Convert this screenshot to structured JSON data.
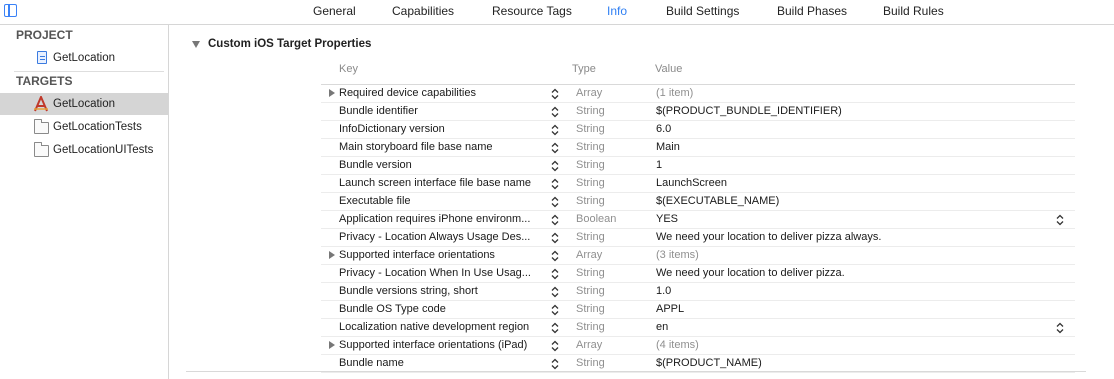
{
  "tabs": [
    {
      "label": "General",
      "active": false
    },
    {
      "label": "Capabilities",
      "active": false
    },
    {
      "label": "Resource Tags",
      "active": false
    },
    {
      "label": "Info",
      "active": true
    },
    {
      "label": "Build Settings",
      "active": false
    },
    {
      "label": "Build Phases",
      "active": false
    },
    {
      "label": "Build Rules",
      "active": false
    }
  ],
  "sidebar": {
    "project_title": "PROJECT",
    "project_items": [
      {
        "label": "GetLocation",
        "icon": "project-document-icon"
      }
    ],
    "targets_title": "TARGETS",
    "target_items": [
      {
        "label": "GetLocation",
        "icon": "app-target-icon",
        "selected": true
      },
      {
        "label": "GetLocationTests",
        "icon": "folder-icon",
        "selected": false
      },
      {
        "label": "GetLocationUITests",
        "icon": "folder-icon",
        "selected": false
      }
    ]
  },
  "main": {
    "section_title": "Custom iOS Target Properties",
    "columns": {
      "key": "Key",
      "type": "Type",
      "value": "Value"
    },
    "rows": [
      {
        "key": "Required device capabilities",
        "type": "Array",
        "value": "(1 item)",
        "expandable": true,
        "value_muted": true
      },
      {
        "key": "Bundle identifier",
        "type": "String",
        "value": "$(PRODUCT_BUNDLE_IDENTIFIER)"
      },
      {
        "key": "InfoDictionary version",
        "type": "String",
        "value": "6.0"
      },
      {
        "key": "Main storyboard file base name",
        "type": "String",
        "value": "Main"
      },
      {
        "key": "Bundle version",
        "type": "String",
        "value": "1"
      },
      {
        "key": "Launch screen interface file base name",
        "type": "String",
        "value": "LaunchScreen"
      },
      {
        "key": "Executable file",
        "type": "String",
        "value": "$(EXECUTABLE_NAME)"
      },
      {
        "key": "Application requires iPhone environm...",
        "type": "Boolean",
        "value": "YES",
        "value_popup": true
      },
      {
        "key": "Privacy - Location Always Usage Des...",
        "type": "String",
        "value": "We need your location to deliver pizza always."
      },
      {
        "key": "Supported interface orientations",
        "type": "Array",
        "value": "(3 items)",
        "expandable": true,
        "value_muted": true
      },
      {
        "key": "Privacy - Location When In Use Usag...",
        "type": "String",
        "value": "We need your location to deliver pizza."
      },
      {
        "key": "Bundle versions string, short",
        "type": "String",
        "value": "1.0"
      },
      {
        "key": "Bundle OS Type code",
        "type": "String",
        "value": "APPL"
      },
      {
        "key": "Localization native development region",
        "type": "String",
        "value": "en",
        "value_popup": true
      },
      {
        "key": "Supported interface orientations (iPad)",
        "type": "Array",
        "value": "(4 items)",
        "expandable": true,
        "value_muted": true
      },
      {
        "key": "Bundle name",
        "type": "String",
        "value": "$(PRODUCT_NAME)"
      }
    ]
  },
  "colors": {
    "accent": "#2f7ff3",
    "selected_row": "#d5d5d5",
    "muted_text": "#8f8f8f"
  }
}
